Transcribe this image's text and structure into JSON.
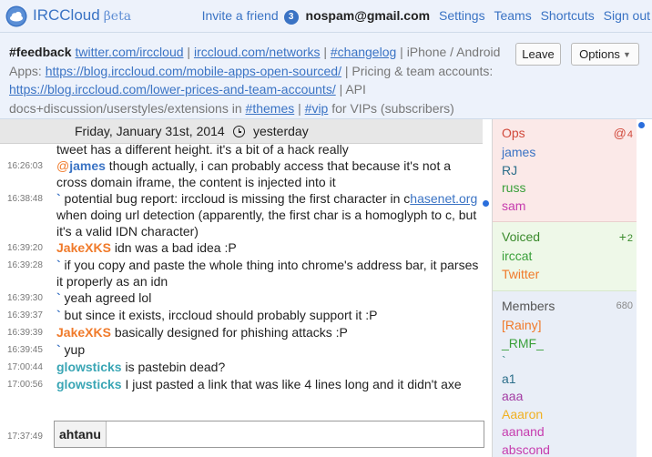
{
  "header": {
    "brand": "IRCCloud",
    "beta": "βeta",
    "invite": "Invite a friend",
    "invite_badge": "3",
    "email": "nospam@gmail.com",
    "settings": "Settings",
    "teams": "Teams",
    "shortcuts": "Shortcuts",
    "signout": "Sign out"
  },
  "topic": {
    "channel": "#feedback",
    "p1": "twitter.com/irccloud",
    "s1": " | ",
    "p2": "irccloud.com/networks",
    "s2": " | ",
    "p3": "#changelog",
    "s3": " | iPhone / Android Apps: ",
    "p4": "https://blog.irccloud.com/mobile-apps-open-sourced/",
    "s4": " | Pricing & team accounts: ",
    "p5": "https://blog.irccloud.com/lower-prices-and-team-accounts/",
    "s5": " | API docs+discussion/userstyles/extensions in ",
    "p6": "#themes",
    "s6": " | ",
    "p7": "#vip",
    "s7": " for VIPs (subscribers)",
    "leave": "Leave",
    "options": "Options",
    "caret": "▼"
  },
  "chat": {
    "date": "Friday, January 31st, 2014",
    "relative": "yesterday",
    "m0": {
      "text": "height gets set once after it's rendered, from inside the iframe, cos each tweet has a different height. it's a bit of a hack really"
    },
    "m1": {
      "ts": "16:26:03",
      "at": "@",
      "nick": "james",
      "text": " though actually, i can probably access that because it's not a cross domain iframe, the content is injected into it"
    },
    "m2": {
      "ts": "16:38:48",
      "bt": "`",
      "pre": " potential bug report: irccloud is missing the first character in c",
      "link": "hasenet.org",
      "post": " when doing url detection (apparently, the first char is a homoglyph to c, but it's a valid IDN character)"
    },
    "m3": {
      "ts": "16:39:20",
      "nick": "JakeXKS",
      "text": " idn was a bad idea :P"
    },
    "m4": {
      "ts": "16:39:28",
      "bt": "`",
      "text": " if you copy and paste the whole thing into chrome's address bar, it parses it properly as an idn"
    },
    "m5": {
      "ts": "16:39:30",
      "bt": "`",
      "text": " yeah agreed lol"
    },
    "m6": {
      "ts": "16:39:37",
      "bt": "`",
      "text": " but since it exists, irccloud should probably support it :P"
    },
    "m7": {
      "ts": "16:39:39",
      "nick": "JakeXKS",
      "text": " basically designed for phishing attacks :P"
    },
    "m8": {
      "ts": "16:39:45",
      "bt": "`",
      "text": " yup"
    },
    "m9": {
      "ts": "17:00:44",
      "nick": "glowsticks",
      "text": " is pastebin dead?"
    },
    "m10": {
      "ts": "17:00:56",
      "nick": "glowsticks",
      "text": " I just pasted a link that was like 4 lines long and it didn't axe"
    },
    "input_ts": "17:37:49",
    "input_nick": "ahtanu"
  },
  "sidebar": {
    "ops": {
      "label": "Ops",
      "sym": "@",
      "count": "4",
      "members": [
        "james",
        "RJ",
        "russ",
        "sam"
      ]
    },
    "voiced": {
      "label": "Voiced",
      "sym": "+",
      "count": "2",
      "members": [
        "irccat",
        "Twitter"
      ]
    },
    "members": {
      "label": "Members",
      "count": "680",
      "list": [
        "[Rainy]",
        "_RMF_",
        "`",
        "a1",
        "aaa",
        "Aaaron",
        "aanand",
        "abscond"
      ]
    }
  },
  "colors": {
    "link": "#3a73c4",
    "unread": "#2a6edc",
    "nick_orange": "#f07a2a",
    "nick_teal": "#3aa6b5"
  }
}
